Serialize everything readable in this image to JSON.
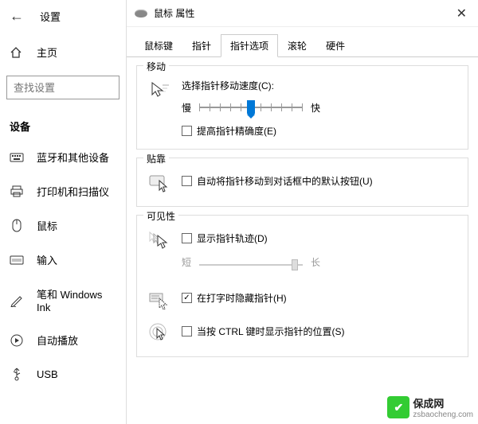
{
  "settings": {
    "title": "设置",
    "home": "主页",
    "search_placeholder": "查找设置",
    "section": "设备",
    "nav": [
      "蓝牙和其他设备",
      "打印机和扫描仪",
      "鼠标",
      "输入",
      "笔和 Windows Ink",
      "自动播放",
      "USB"
    ]
  },
  "dialog": {
    "title": "鼠标 属性",
    "tabs": [
      "鼠标键",
      "指针",
      "指针选项",
      "滚轮",
      "硬件"
    ],
    "active_tab": 2,
    "motion": {
      "group": "移动",
      "label": "选择指针移动速度(C):",
      "slow": "慢",
      "fast": "快",
      "enhance": "提高指针精确度(E)"
    },
    "snap": {
      "group": "贴靠",
      "label": "自动将指针移动到对话框中的默认按钮(U)"
    },
    "visibility": {
      "group": "可见性",
      "trails": "显示指针轨迹(D)",
      "short": "短",
      "long": "长",
      "hide_typing": "在打字时隐藏指针(H)",
      "ctrl_locate": "当按 CTRL 键时显示指针的位置(S)"
    }
  },
  "watermark": {
    "cn": "保成网",
    "url": "zsbaocheng.com"
  }
}
